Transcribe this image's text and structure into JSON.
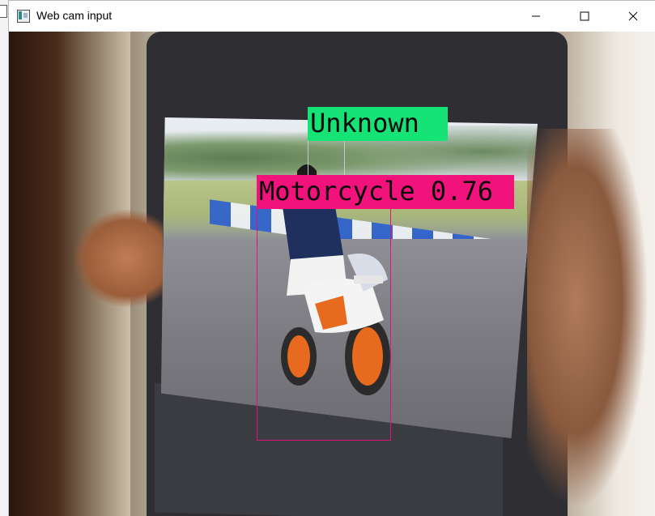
{
  "window": {
    "title": "Web cam input",
    "controls": {
      "minimize": "minimize-icon",
      "maximize": "maximize-icon",
      "close": "close-icon"
    }
  },
  "detections": [
    {
      "label": "Unknown",
      "box_color": "#c9c9c9",
      "label_bg": "#16e376"
    },
    {
      "label": "Motorcycle 0.76",
      "box_color": "#e0127a",
      "label_bg": "#f2127c"
    }
  ]
}
